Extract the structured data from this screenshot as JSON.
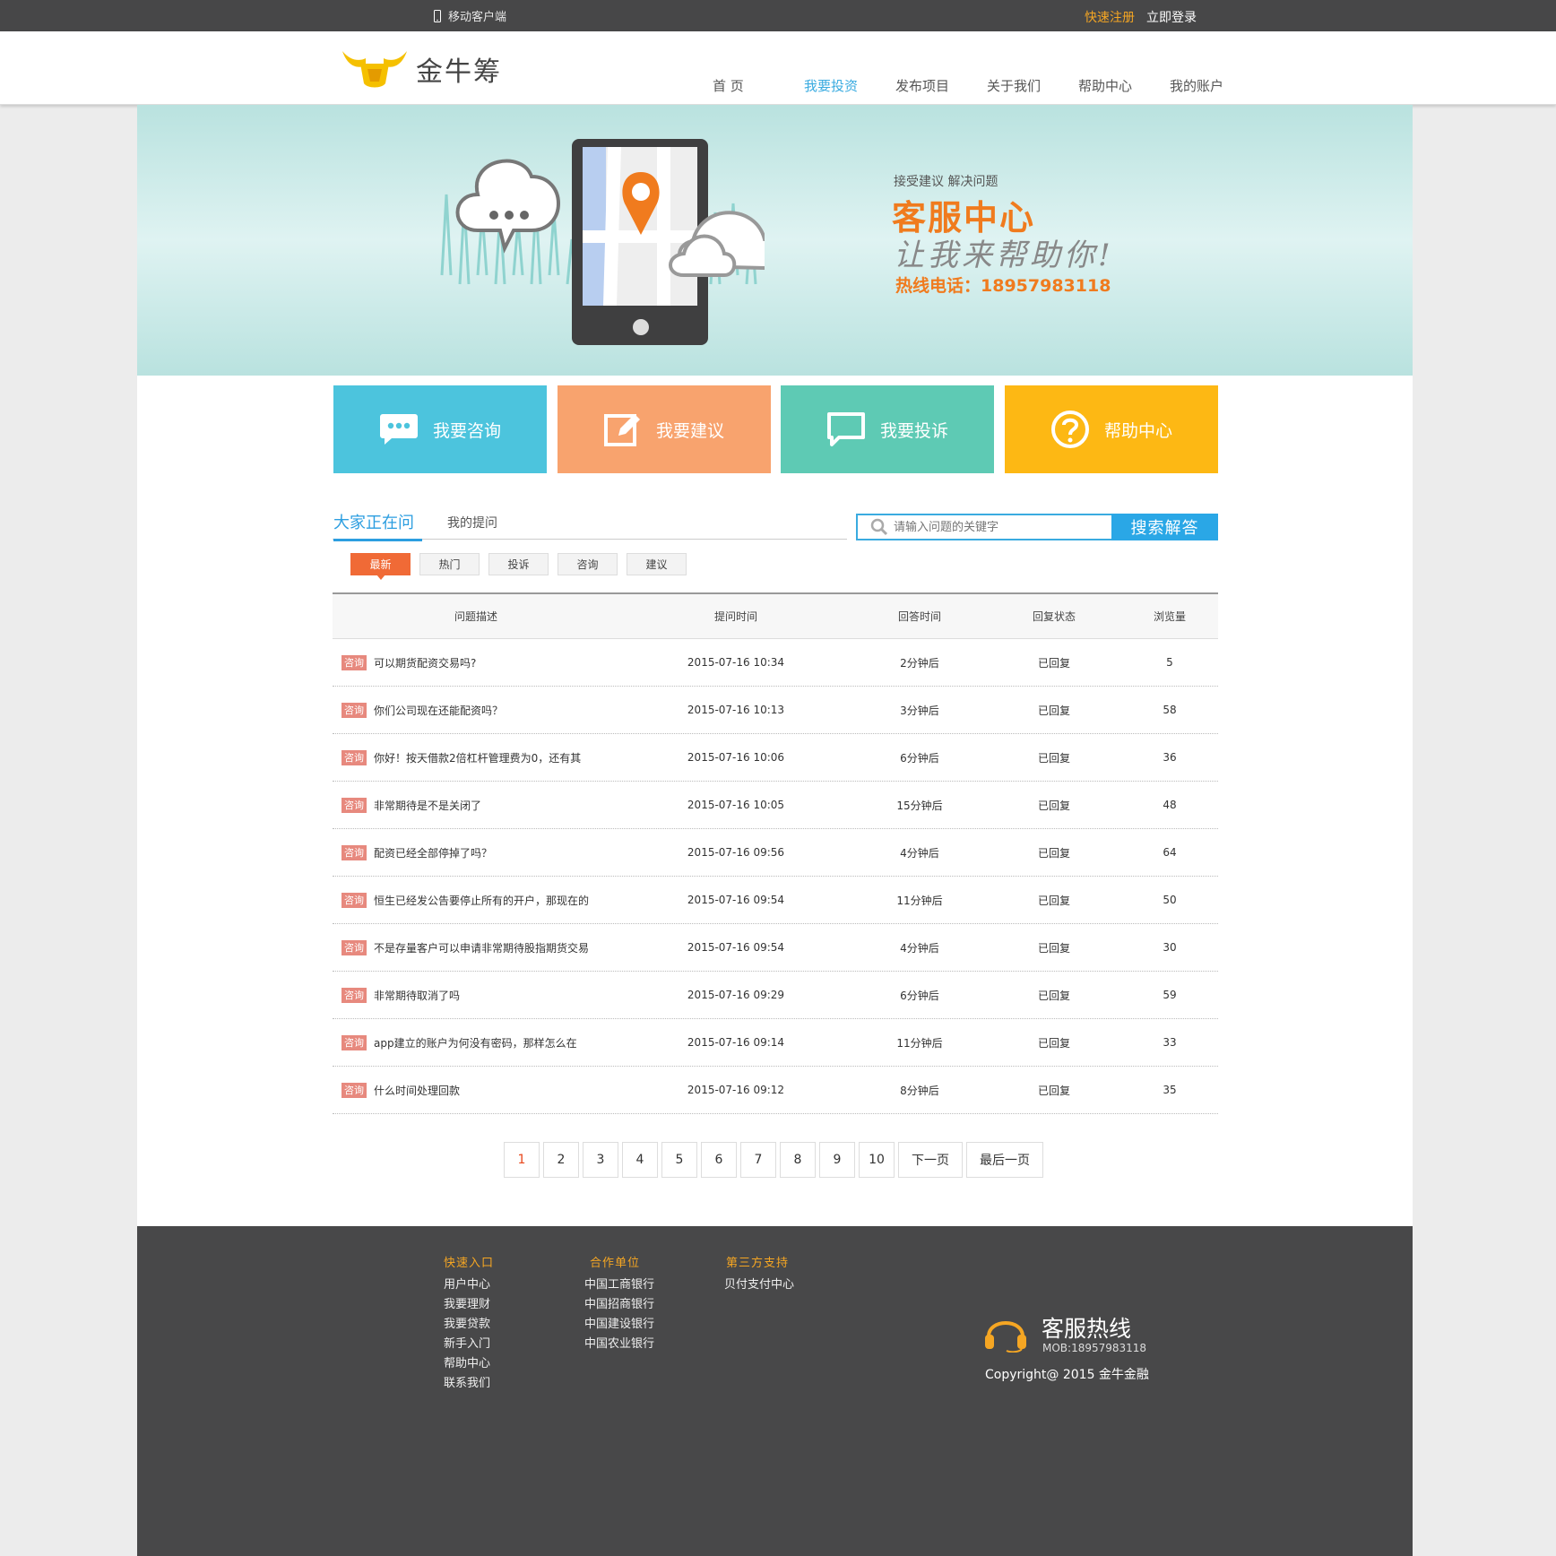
{
  "topbar": {
    "mobile_label": "移动客户端",
    "register": "快速注册",
    "login": "立即登录"
  },
  "header": {
    "logo_text": "金牛筹",
    "nav": [
      "首 页",
      "我要投资",
      "发布项目",
      "关于我们",
      "帮助中心",
      "我的账户"
    ],
    "active_nav": 1
  },
  "banner": {
    "subtitle": "接受建议  解决问题",
    "title": "客服中心",
    "slogan": "让我来帮助你!",
    "hotline": "热线电话：18957983118"
  },
  "tiles": [
    {
      "label": "我要咨询",
      "color": "#4cc4dd",
      "icon": "chat-bubble-icon"
    },
    {
      "label": "我要建议",
      "color": "#f8a36e",
      "icon": "edit-icon"
    },
    {
      "label": "我要投诉",
      "color": "#5ecab4",
      "icon": "message-icon"
    },
    {
      "label": "帮助中心",
      "color": "#fdb814",
      "icon": "question-icon"
    }
  ],
  "tabs": {
    "active": "大家正在问",
    "other": "我的提问"
  },
  "search": {
    "placeholder": "请输入问题的关键字",
    "button": "搜索解答"
  },
  "filters": [
    "最新",
    "热门",
    "投诉",
    "咨询",
    "建议"
  ],
  "table": {
    "headers": [
      "问题描述",
      "提问时间",
      "回答时间",
      "回复状态",
      "浏览量"
    ],
    "rows": [
      {
        "tag": "咨询",
        "question": "可以期货配资交易吗?",
        "time": "2015-07-16 10:34",
        "answer": "2分钟后",
        "status": "已回复",
        "views": "5"
      },
      {
        "tag": "咨询",
        "question": "你们公司现在还能配资吗？",
        "time": "2015-07-16 10:13",
        "answer": "3分钟后",
        "status": "已回复",
        "views": "58"
      },
      {
        "tag": "咨询",
        "question": "你好！按天借款2倍杠杆管理费为0，还有其",
        "time": "2015-07-16 10:06",
        "answer": "6分钟后",
        "status": "已回复",
        "views": "36"
      },
      {
        "tag": "咨询",
        "question": "非常期待是不是关闭了",
        "time": "2015-07-16 10:05",
        "answer": "15分钟后",
        "status": "已回复",
        "views": "48"
      },
      {
        "tag": "咨询",
        "question": "配资已经全部停掉了吗？",
        "time": "2015-07-16 09:56",
        "answer": "4分钟后",
        "status": "已回复",
        "views": "64"
      },
      {
        "tag": "咨询",
        "question": "恒生已经发公告要停止所有的开户，那现在的",
        "time": "2015-07-16 09:54",
        "answer": "11分钟后",
        "status": "已回复",
        "views": "50"
      },
      {
        "tag": "咨询",
        "question": "不是存量客户可以申请非常期待股指期货交易",
        "time": "2015-07-16 09:54",
        "answer": "4分钟后",
        "status": "已回复",
        "views": "30"
      },
      {
        "tag": "咨询",
        "question": "非常期待取消了吗",
        "time": "2015-07-16 09:29",
        "answer": "6分钟后",
        "status": "已回复",
        "views": "59"
      },
      {
        "tag": "咨询",
        "question": "app建立的账户为何没有密码，那样怎么在",
        "time": "2015-07-16 09:14",
        "answer": "11分钟后",
        "status": "已回复",
        "views": "33"
      },
      {
        "tag": "咨询",
        "question": "什么时间处理回款",
        "time": "2015-07-16 09:12",
        "answer": "8分钟后",
        "status": "已回复",
        "views": "35"
      }
    ]
  },
  "pagination": {
    "pages": [
      "1",
      "2",
      "3",
      "4",
      "5",
      "6",
      "7",
      "8",
      "9",
      "10"
    ],
    "next": "下一页",
    "last": "最后一页",
    "current": "1"
  },
  "footer": {
    "quick": {
      "title": "快速入口",
      "links": [
        "用户中心",
        "我要理财",
        "我要贷款",
        "新手入门",
        "帮助中心",
        "联系我们"
      ]
    },
    "partners": {
      "title": "合作单位",
      "links": [
        "中国工商银行",
        "中国招商银行",
        "中国建设银行",
        "中国农业银行"
      ]
    },
    "third": {
      "title": "第三方支持",
      "links": [
        "贝付支付中心"
      ]
    },
    "service_title": "客服热线",
    "service_mob": "MOB:18957983118",
    "copyright": "Copyright@ 2015  金牛金融"
  }
}
